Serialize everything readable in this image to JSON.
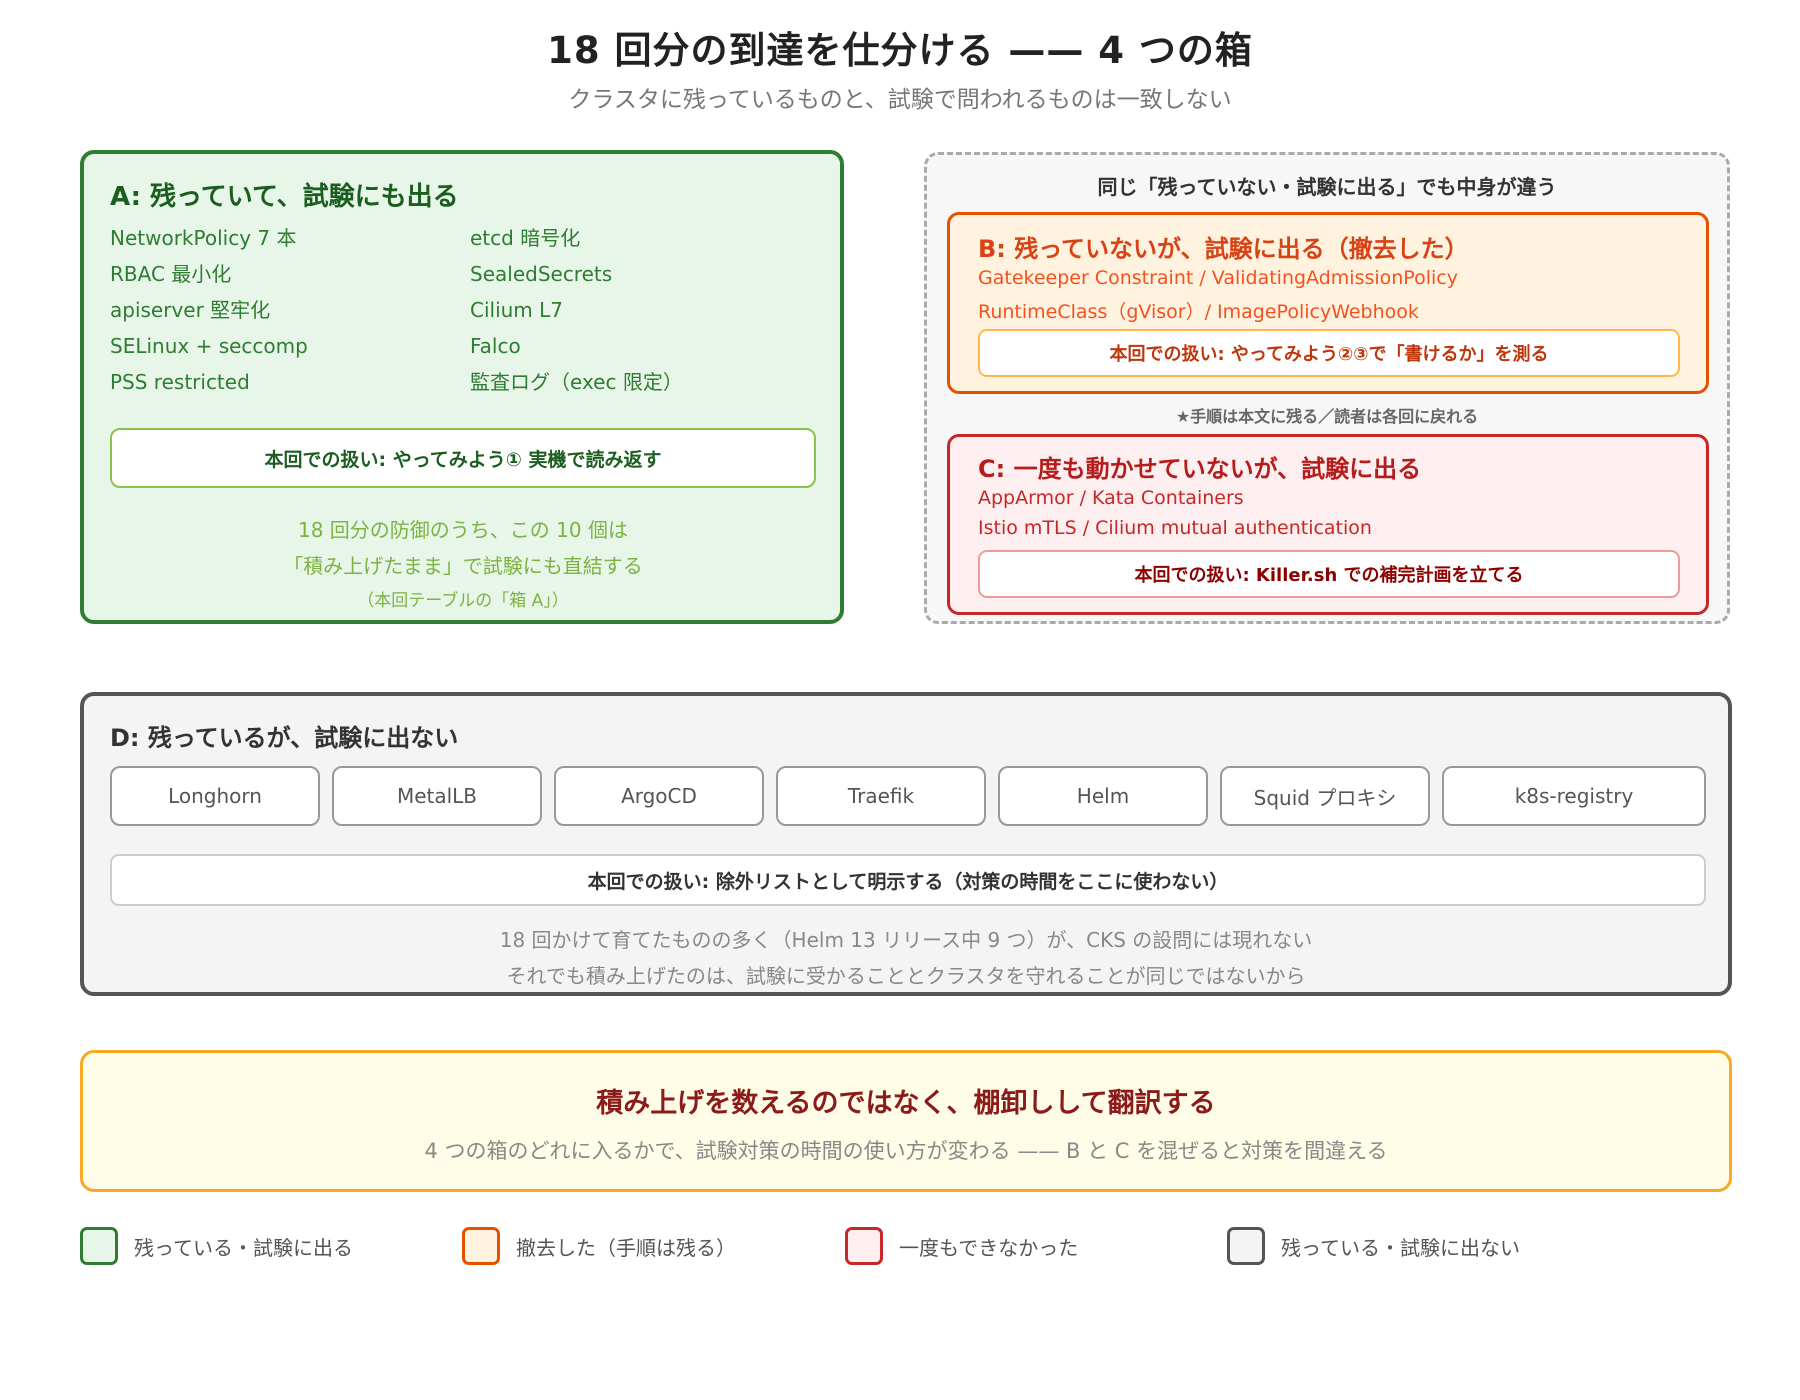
{
  "title": "18 回分の到達を仕分ける —— 4 つの箱",
  "subtitle": "クラスタに残っているものと、試験で問われるものは一致しない",
  "box_a": {
    "heading": "A: 残っていて、試験にも出る",
    "items": [
      "NetworkPolicy 7 本",
      "etcd 暗号化",
      "RBAC 最小化",
      "SealedSecrets",
      "apiserver 堅牢化",
      "Cilium L7",
      "SELinux + seccomp",
      "Falco",
      "PSS restricted",
      "監査ログ（exec 限定）"
    ],
    "handling": "本回での扱い: やってみよう① 実機で読み返す",
    "note_line1": "18 回分の防御のうち、この 10 個は",
    "note_line2": "「積み上げたまま」で試験にも直結する",
    "note_line3": "（本回テーブルの「箱 A」）"
  },
  "group": {
    "title": "同じ「残っていない・試験に出る」でも中身が違う",
    "star_note": "★手順は本文に残る／読者は各回に戻れる"
  },
  "box_b": {
    "heading": "B: 残っていないが、試験に出る（撤去した）",
    "line1": "Gatekeeper Constraint / ValidatingAdmissionPolicy",
    "line2": "RuntimeClass（gVisor）/ ImagePolicyWebhook",
    "handling": "本回での扱い: やってみよう②③で「書けるか」を測る"
  },
  "box_c": {
    "heading": "C: 一度も動かせていないが、試験に出る",
    "line1": "AppArmor / Kata Containers",
    "line2": "Istio mTLS / Cilium mutual authentication",
    "handling": "本回での扱い: Killer.sh での補完計画を立てる"
  },
  "box_d": {
    "heading": "D: 残っているが、試験に出ない",
    "items": [
      "Longhorn",
      "MetalLB",
      "ArgoCD",
      "Traefik",
      "Helm",
      "Squid プロキシ",
      "k8s-registry"
    ],
    "handling": "本回での扱い: 除外リストとして明示する（対策の時間をここに使わない）",
    "note_line1": "18 回かけて育てたものの多く（Helm 13 リリース中 9 つ）が、CKS の設問には現れない",
    "note_line2": "それでも積み上げたのは、試験に受かることとクラスタを守れることが同じではないから"
  },
  "conclusion": {
    "title": "積み上げを数えるのではなく、棚卸しして翻訳する",
    "subtitle": "4 つの箱のどれに入るかで、試験対策の時間の使い方が変わる —— B と C を混ぜると対策を間違える"
  },
  "legend": [
    {
      "label": "残っている・試験に出る",
      "fill": "#e8f5e9",
      "border": "#2e7d32"
    },
    {
      "label": "撤去した（手順は残る）",
      "fill": "#fff3e0",
      "border": "#e65100"
    },
    {
      "label": "一度もできなかった",
      "fill": "#fdeff0",
      "border": "#c62828"
    },
    {
      "label": "残っている・試験に出ない",
      "fill": "#f4f4f4",
      "border": "#555555"
    }
  ]
}
